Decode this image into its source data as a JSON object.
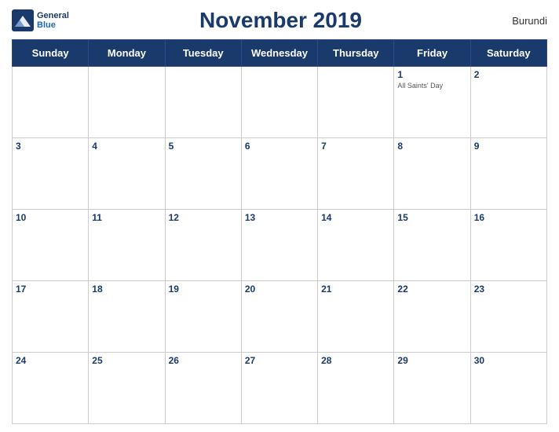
{
  "header": {
    "logo_general": "General",
    "logo_blue": "Blue",
    "title": "November 2019",
    "country": "Burundi"
  },
  "days_of_week": [
    "Sunday",
    "Monday",
    "Tuesday",
    "Wednesday",
    "Thursday",
    "Friday",
    "Saturday"
  ],
  "weeks": [
    [
      {
        "day": "",
        "holiday": ""
      },
      {
        "day": "",
        "holiday": ""
      },
      {
        "day": "",
        "holiday": ""
      },
      {
        "day": "",
        "holiday": ""
      },
      {
        "day": "",
        "holiday": ""
      },
      {
        "day": "1",
        "holiday": "All Saints' Day"
      },
      {
        "day": "2",
        "holiday": ""
      }
    ],
    [
      {
        "day": "3",
        "holiday": ""
      },
      {
        "day": "4",
        "holiday": ""
      },
      {
        "day": "5",
        "holiday": ""
      },
      {
        "day": "6",
        "holiday": ""
      },
      {
        "day": "7",
        "holiday": ""
      },
      {
        "day": "8",
        "holiday": ""
      },
      {
        "day": "9",
        "holiday": ""
      }
    ],
    [
      {
        "day": "10",
        "holiday": ""
      },
      {
        "day": "11",
        "holiday": ""
      },
      {
        "day": "12",
        "holiday": ""
      },
      {
        "day": "13",
        "holiday": ""
      },
      {
        "day": "14",
        "holiday": ""
      },
      {
        "day": "15",
        "holiday": ""
      },
      {
        "day": "16",
        "holiday": ""
      }
    ],
    [
      {
        "day": "17",
        "holiday": ""
      },
      {
        "day": "18",
        "holiday": ""
      },
      {
        "day": "19",
        "holiday": ""
      },
      {
        "day": "20",
        "holiday": ""
      },
      {
        "day": "21",
        "holiday": ""
      },
      {
        "day": "22",
        "holiday": ""
      },
      {
        "day": "23",
        "holiday": ""
      }
    ],
    [
      {
        "day": "24",
        "holiday": ""
      },
      {
        "day": "25",
        "holiday": ""
      },
      {
        "day": "26",
        "holiday": ""
      },
      {
        "day": "27",
        "holiday": ""
      },
      {
        "day": "28",
        "holiday": ""
      },
      {
        "day": "29",
        "holiday": ""
      },
      {
        "day": "30",
        "holiday": ""
      }
    ]
  ]
}
